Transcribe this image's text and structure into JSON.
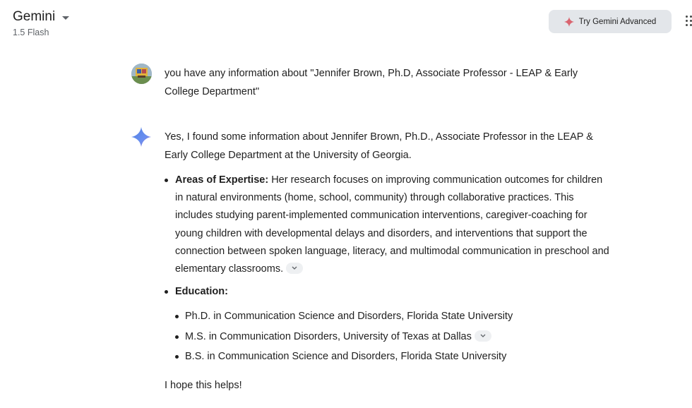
{
  "header": {
    "app_title": "Gemini",
    "model_version": "1.5 Flash",
    "advanced_button_label": "Try Gemini Advanced"
  },
  "conversation": {
    "user_query": "you have any information about \"Jennifer Brown, Ph.D, Associate Professor - LEAP & Early College Department\"",
    "response": {
      "intro": "Yes, I found some information about Jennifer Brown, Ph.D., Associate Professor in the LEAP & Early College Department at the University of Georgia.",
      "expertise_label": "Areas of Expertise:",
      "expertise_text": " Her research focuses on improving communication outcomes for children in natural environments (home, school, community) through collaborative practices. This includes studying parent-implemented communication interventions, caregiver-coaching for young children with developmental delays and disorders, and interventions that support the connection between spoken language, literacy, and multimodal communication in preschool and elementary classrooms.",
      "education_label": "Education:",
      "education": [
        "Ph.D. in Communication Science and Disorders, Florida State University",
        "M.S. in Communication Disorders, University of Texas at Dallas",
        "B.S. in Communication Science and Disorders, Florida State University"
      ],
      "closing": "I hope this helps!"
    }
  },
  "icons": {
    "spark": "gemini-spark-icon",
    "caret": "chevron-down-icon",
    "apps": "apps-grid-icon"
  },
  "colors": {
    "advanced_button_bg": "#e3e6ea",
    "spark_blue": "#4f7fe0",
    "spark_red": "#d96570",
    "text": "#1f1f1f"
  }
}
